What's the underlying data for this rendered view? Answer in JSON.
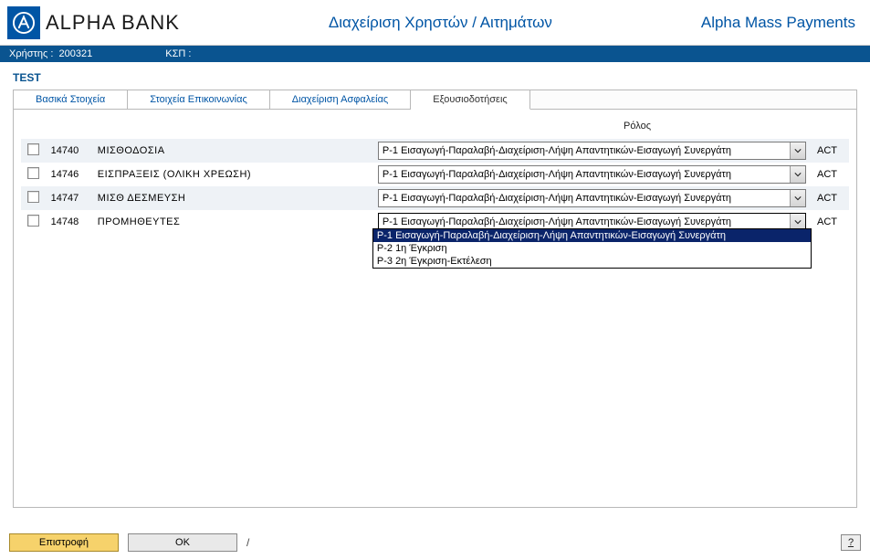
{
  "header": {
    "bank_name": "ALPHA BANK",
    "center_title": "Διαχείριση Χρηστών / Αιτημάτων",
    "right_title": "Alpha Mass Payments"
  },
  "info_bar": {
    "user_label": "Χρήστης :",
    "user_value": "200321",
    "ksp_label": "ΚΣΠ :",
    "ksp_value": ""
  },
  "page_title": "TEST",
  "tabs": [
    {
      "label": "Βασικά Στοιχεία",
      "active": false
    },
    {
      "label": "Στοιχεία Επικοινωνίας",
      "active": false
    },
    {
      "label": "Διαχείριση Ασφαλείας",
      "active": false
    },
    {
      "label": "Εξουσιοδοτήσεις",
      "active": true
    }
  ],
  "role_header": "Ρόλος",
  "rows": [
    {
      "code": "14740",
      "desc": "ΜΙΣΘΟΔΟΣΙΑ",
      "selected": "P-1 Εισαγωγή-Παραλαβή-Διαχείριση-Λήψη Απαντητικών-Εισαγωγή Συνεργάτη",
      "status": "ACT",
      "open": false,
      "odd": true
    },
    {
      "code": "14746",
      "desc": "ΕΙΣΠΡΑΞΕΙΣ (ΟΛΙΚΗ ΧΡΕΩΣΗ)",
      "selected": "P-1 Εισαγωγή-Παραλαβή-Διαχείριση-Λήψη Απαντητικών-Εισαγωγή Συνεργάτη",
      "status": "ACT",
      "open": false,
      "odd": false
    },
    {
      "code": "14747",
      "desc": "ΜΙΣΘ ΔΕΣΜΕΥΣΗ",
      "selected": "P-1 Εισαγωγή-Παραλαβή-Διαχείριση-Λήψη Απαντητικών-Εισαγωγή Συνεργάτη",
      "status": "ACT",
      "open": false,
      "odd": true
    },
    {
      "code": "14748",
      "desc": "ΠΡΟΜΗΘΕΥΤΕΣ",
      "selected": "P-1 Εισαγωγή-Παραλαβή-Διαχείριση-Λήψη Απαντητικών-Εισαγωγή Συνεργάτη",
      "status": "ACT",
      "open": true,
      "odd": false
    }
  ],
  "dropdown_options": [
    "P-1 Εισαγωγή-Παραλαβή-Διαχείριση-Λήψη Απαντητικών-Εισαγωγή Συνεργάτη",
    "P-2 1η Έγκριση",
    "P-3 2η Έγκριση-Εκτέλεση"
  ],
  "footer": {
    "back": "Επιστροφή",
    "ok": "OK",
    "sep": "/",
    "help": "?"
  }
}
